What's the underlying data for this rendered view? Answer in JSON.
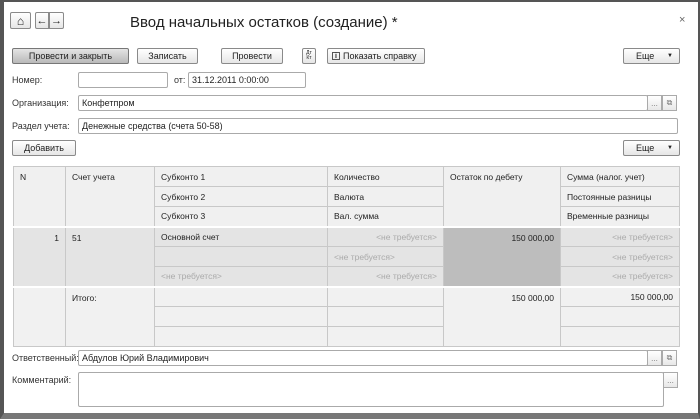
{
  "window": {
    "title": "Ввод начальных остатков (создание) *",
    "close": "×"
  },
  "nav": {
    "home": "⌂",
    "back": "←",
    "forward": "→"
  },
  "toolbar": {
    "post_close": "Провести и закрыть",
    "save": "Записать",
    "post": "Провести",
    "dtkt_top": "Дт",
    "dtkt_bottom": "Кт",
    "help": "Показать справку",
    "help_icon": "i",
    "more": "Еще",
    "arrow": "▼"
  },
  "form": {
    "number_label": "Номер:",
    "number_value": "",
    "date_label": "от:",
    "date_value": "31.12.2011  0:00:00",
    "org_label": "Организация:",
    "org_value": "Конфетпром",
    "section_label": "Раздел учета:",
    "section_value": "Денежные средства (счета 50-58)",
    "add": "Добавить",
    "more": "Еще",
    "resp_label": "Ответственный:",
    "resp_value": "Абдулов Юрий Владимирович",
    "comment_label": "Комментарий:",
    "comment_value": "",
    "ellipsis": "...",
    "open": "⧉"
  },
  "table": {
    "headers": {
      "n": "N",
      "account": "Счет учета",
      "sub1": "Субконто 1",
      "sub2": "Субконто 2",
      "sub3": "Субконто 3",
      "qty": "Количество",
      "currency": "Валюта",
      "cur_sum": "Вал. сумма",
      "debit": "Остаток по дебету",
      "tax_sum": "Сумма (налог. учет)",
      "perm": "Постоянные разницы",
      "temp": "Временные разницы"
    },
    "row": {
      "n": "1",
      "account": "51",
      "sub1": "Основной счет",
      "sub2": "",
      "sub3": "<не требуется>",
      "qty": "<не требуется>",
      "currency": "<не требуется>",
      "cur_sum": "<не требуется>",
      "debit": "150 000,00",
      "tax_sum": "<не требуется>",
      "perm": "<не требуется>",
      "temp": "<не требуется>"
    },
    "total": {
      "label": "Итого:",
      "debit": "150 000,00",
      "tax_sum": "150 000,00"
    }
  }
}
